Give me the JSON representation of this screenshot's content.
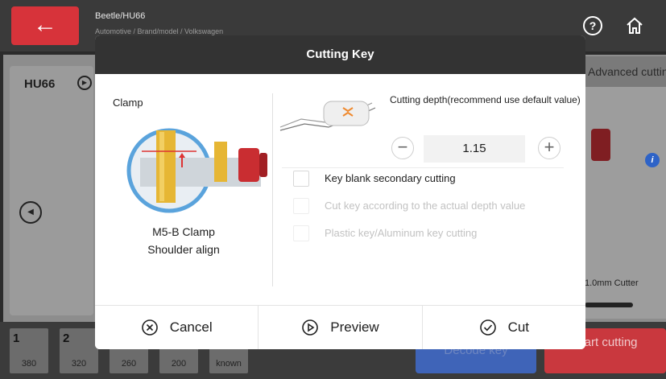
{
  "topbar": {
    "breadcrumb_title": "Beetle/HU66",
    "breadcrumb_sub": "Automotive / Brand/model / Volkswagen",
    "help_icon": "question-circle-icon",
    "home_icon": "home-icon",
    "back_icon": "arrow-left-icon"
  },
  "background": {
    "key_model": "HU66",
    "advanced_tab": "Advanced cutting",
    "cutter_label": "1.0mm Cutter",
    "decode_label": "Decode key",
    "start_label": "Start cutting",
    "depth_tiles": [
      {
        "num": "1",
        "val": "380"
      },
      {
        "num": "2",
        "val": "320"
      },
      {
        "num": "",
        "val": "260"
      },
      {
        "num": "",
        "val": "200"
      },
      {
        "num": "",
        "val": "known"
      }
    ]
  },
  "dialog": {
    "title": "Cutting Key",
    "clamp": {
      "title": "Clamp",
      "name": "M5-B Clamp",
      "align": "Shoulder align"
    },
    "depth": {
      "label": "Cutting depth(recommend use default value)",
      "value": "1.15",
      "minus": "−",
      "plus": "+"
    },
    "options": [
      {
        "label": "Key blank secondary cutting",
        "checked": false,
        "enabled": true
      },
      {
        "label": "Cut key according to the actual depth value",
        "checked": false,
        "enabled": false
      },
      {
        "label": "Plastic key/Aluminum key cutting",
        "checked": false,
        "enabled": false
      }
    ],
    "footer": {
      "cancel": "Cancel",
      "preview": "Preview",
      "cut": "Cut"
    }
  },
  "colors": {
    "accent_red": "#d7333a",
    "header_dark": "#333333",
    "decode_blue": "#3f64b8"
  }
}
